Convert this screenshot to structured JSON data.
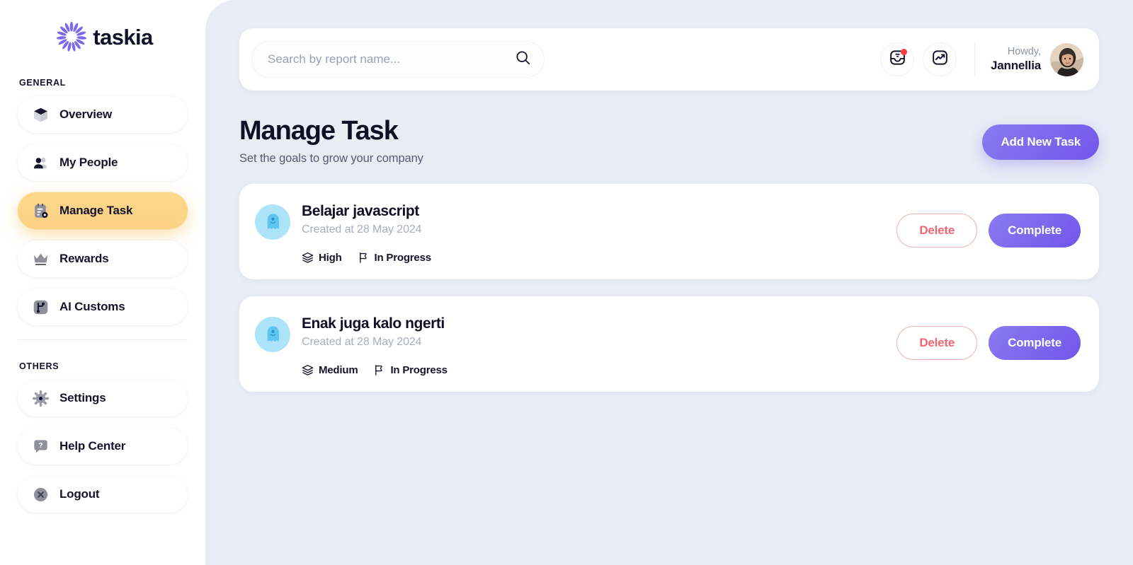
{
  "brand": {
    "name": "taskia",
    "logo_icon": "sunburst-flower-icon",
    "accent_purple": "#7156ea",
    "accent_amber": "#fcd185",
    "danger": "#f0666f",
    "canvas": "#e9ecf5"
  },
  "sidebar": {
    "general_label": "GENERAL",
    "others_label": "OTHERS",
    "general_items": [
      {
        "label": "Overview",
        "icon": "cube-box-icon",
        "active": false
      },
      {
        "label": "My People",
        "icon": "users-group-icon",
        "active": false
      },
      {
        "label": "Manage Task",
        "icon": "clipboard-task-icon",
        "active": true
      },
      {
        "label": "Rewards",
        "icon": "crown-icon",
        "active": false
      },
      {
        "label": "AI Customs",
        "icon": "branch-node-icon",
        "active": false
      }
    ],
    "others_items": [
      {
        "label": "Settings",
        "icon": "gear-icon",
        "active": false
      },
      {
        "label": "Help Center",
        "icon": "question-bubble-icon",
        "active": false
      },
      {
        "label": "Logout",
        "icon": "close-circle-icon",
        "active": false
      }
    ]
  },
  "topbar": {
    "search": {
      "placeholder": "Search by report name...",
      "value": "",
      "icon": "search-icon"
    },
    "icons": [
      {
        "name": "inbox-notification-icon",
        "has_badge": true
      },
      {
        "name": "activity-chart-icon",
        "has_badge": false
      }
    ],
    "user": {
      "greeting": "Howdy,",
      "name": "Jannellia",
      "avatar": "user-photo-avatar"
    }
  },
  "page": {
    "title": "Manage Task",
    "subtitle": "Set the goals to grow your company",
    "primary_action": "Add New Task"
  },
  "tasks": [
    {
      "title": "Belajar javascript",
      "created": "Created at 28 May 2024",
      "avatar_icon": "ghost-avatar-icon",
      "priority": {
        "label": "High",
        "icon": "layers-stack-icon"
      },
      "status": {
        "label": "In Progress",
        "icon": "flag-icon"
      },
      "delete_label": "Delete",
      "complete_label": "Complete"
    },
    {
      "title": "Enak juga kalo ngerti",
      "created": "Created at 28 May 2024",
      "avatar_icon": "ghost-avatar-icon",
      "priority": {
        "label": "Medium",
        "icon": "layers-stack-icon"
      },
      "status": {
        "label": "In Progress",
        "icon": "flag-icon"
      },
      "delete_label": "Delete",
      "complete_label": "Complete"
    }
  ]
}
